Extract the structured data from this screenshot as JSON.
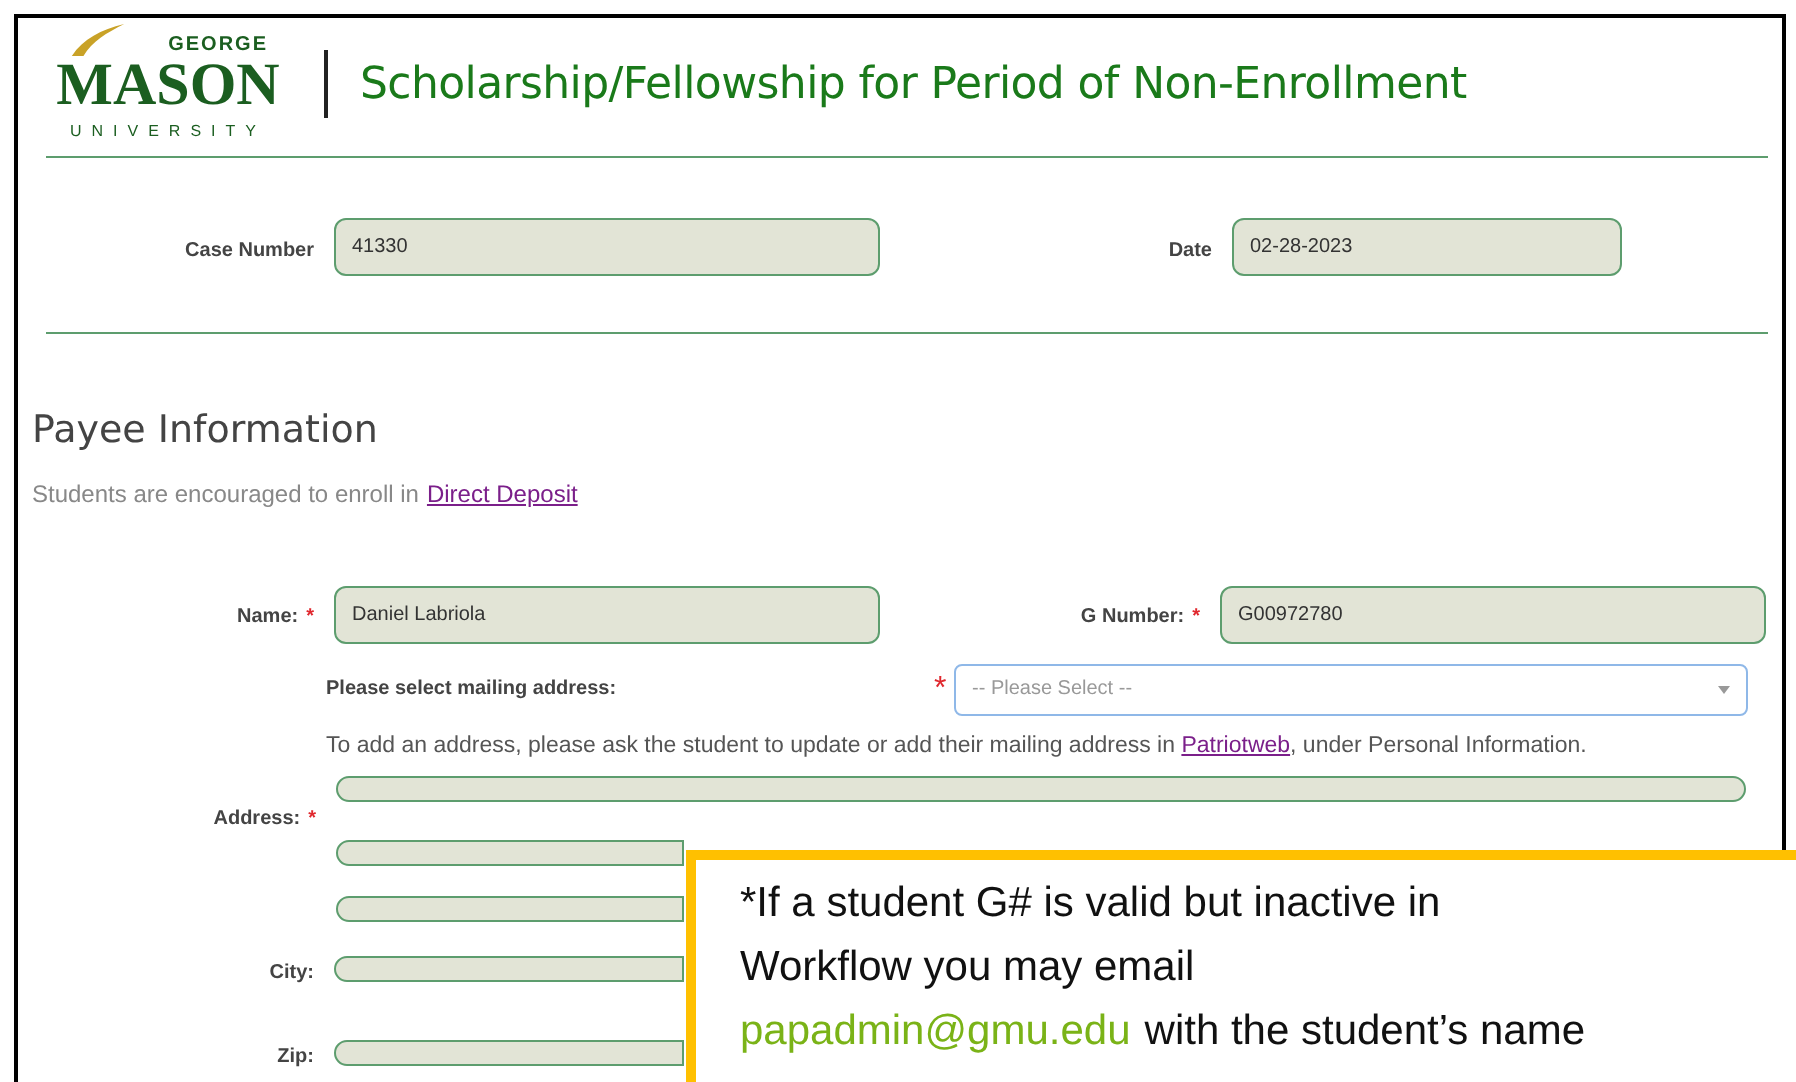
{
  "logo": {
    "top": "GEORGE",
    "main": "MASON",
    "bottom": "UNIVERSITY"
  },
  "required_mark": "*",
  "title": "Scholarship/Fellowship for Period of Non-Enrollment",
  "case_fields": [
    {
      "label": "Case Number",
      "value": "41330"
    },
    {
      "label": "Date",
      "value": "02-28-2023"
    }
  ],
  "payee": {
    "heading": "Payee Information",
    "note": "Students are encouraged to enroll in",
    "note_link": "Direct Deposit",
    "name": {
      "label": "Name:",
      "required": true,
      "value": "Daniel Labriola"
    },
    "g_number": {
      "label": "G Number:",
      "required": true,
      "value": "G00972780"
    },
    "mailing": {
      "label": "Please select mailing address:",
      "required": true,
      "placeholder": "-- Please Select --"
    },
    "help": {
      "before": "To add an address, please ask the student to update or add their mailing address in",
      "link": "Patriotweb",
      "after": ", under Personal Information."
    },
    "address": {
      "label": "Address:",
      "required": true
    },
    "city": {
      "label": "City:"
    },
    "zip": {
      "label": "Zip:"
    }
  },
  "callout": {
    "lines": [
      "*If a student G# is valid but inactive in",
      "Workflow you may email"
    ],
    "email": "papadmin@gmu.edu",
    "after_email": "with the student’s name"
  }
}
